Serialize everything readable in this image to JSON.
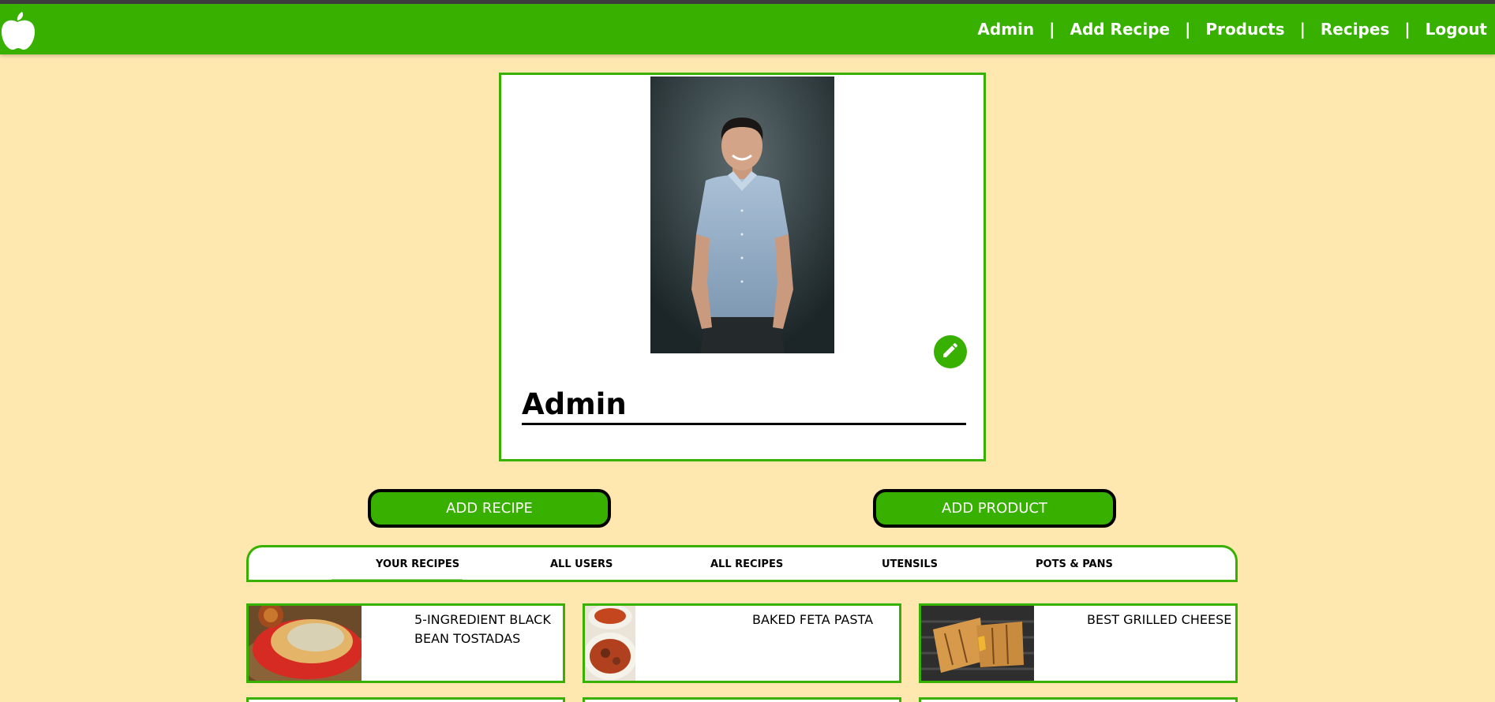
{
  "app": {
    "logo_icon": "apple-icon",
    "brand_color": "#37b000"
  },
  "nav": {
    "links": [
      "Admin",
      "Add Recipe",
      "Products",
      "Recipes",
      "Logout"
    ],
    "separator": "|"
  },
  "profile": {
    "name": "Admin",
    "edit_icon": "pencil-icon"
  },
  "actions": {
    "add_recipe": "ADD RECIPE",
    "add_product": "ADD PRODUCT"
  },
  "tabs": {
    "items": [
      "YOUR RECIPES",
      "ALL USERS",
      "ALL RECIPES",
      "UTENSILS",
      "POTS & PANS"
    ],
    "active": "YOUR RECIPES"
  },
  "recipes": [
    {
      "title_line1": "5-INGREDIENT BLACK",
      "title_line2": "BEAN TOSTADAS"
    },
    {
      "title_line1": "BAKED FETA PASTA",
      "title_line2": ""
    },
    {
      "title_line1": "BEST GRILLED CHEESE",
      "title_line2": ""
    }
  ]
}
